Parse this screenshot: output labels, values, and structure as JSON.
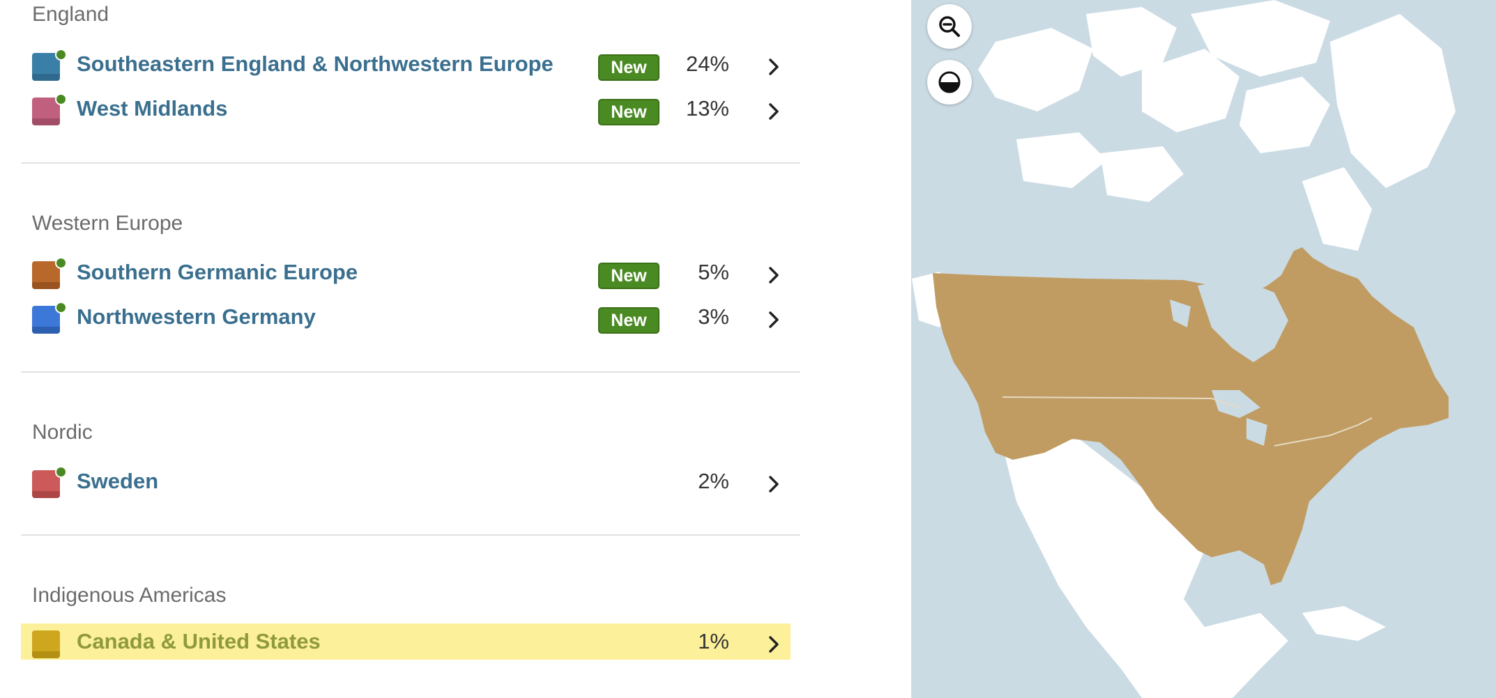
{
  "badge_new": "New",
  "groups": [
    {
      "title": "England",
      "items": [
        {
          "name": "Southeastern England & Northwestern Europe",
          "percent": "24%",
          "is_new": true,
          "color": "#3a7fa8"
        },
        {
          "name": "West Midlands",
          "percent": "13%",
          "is_new": true,
          "color": "#c0607e"
        }
      ]
    },
    {
      "title": "Western Europe",
      "items": [
        {
          "name": "Southern Germanic Europe",
          "percent": "5%",
          "is_new": true,
          "color": "#b8682b"
        },
        {
          "name": "Northwestern Germany",
          "percent": "3%",
          "is_new": true,
          "color": "#3b78d8"
        }
      ]
    },
    {
      "title": "Nordic",
      "items": [
        {
          "name": "Sweden",
          "percent": "2%",
          "is_new": false,
          "color": "#cc5a5a"
        }
      ]
    },
    {
      "title": "Indigenous Americas",
      "items": [
        {
          "name": "Canada & United States",
          "percent": "1%",
          "is_new": false,
          "color": "#cfa71f",
          "highlighted": true
        }
      ]
    }
  ],
  "map": {
    "controls": [
      "zoom-out-icon",
      "contrast-icon"
    ],
    "ocean_color": "#cbdbe4",
    "land_color": "#ffffff",
    "highlight_region": "Canada & United States",
    "highlight_color": "#c09c62"
  }
}
